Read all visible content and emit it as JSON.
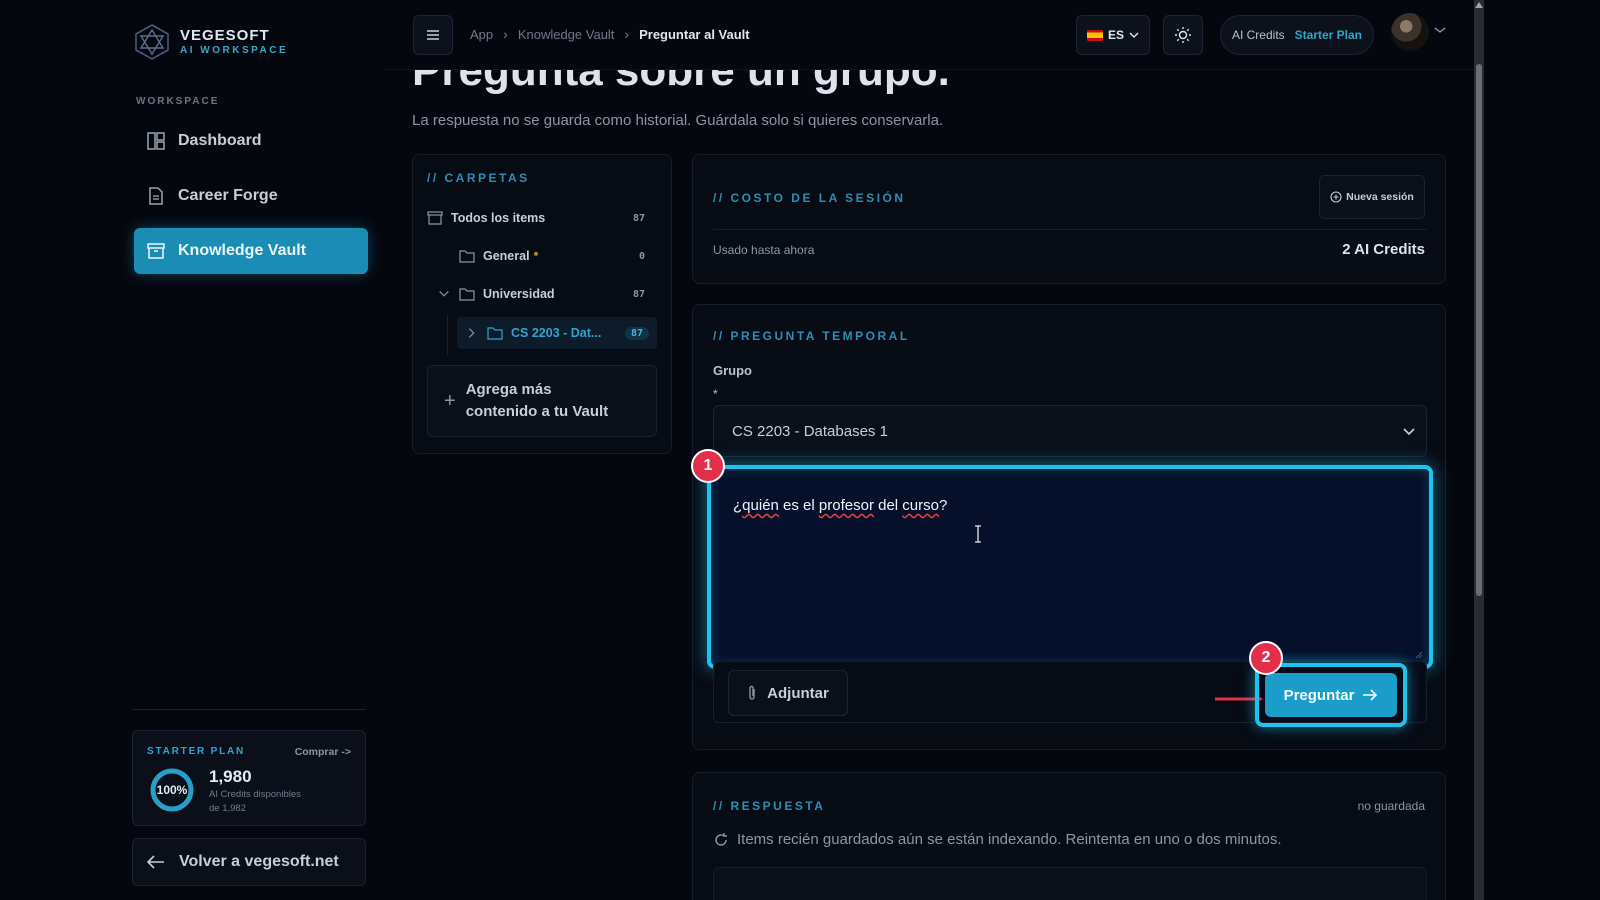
{
  "brand": {
    "name": "VEGESOFT",
    "subtitle": "AI WORKSPACE"
  },
  "sidebar": {
    "section_label": "WORKSPACE",
    "items": [
      {
        "label": "Dashboard",
        "icon": "dashboard-icon",
        "active": false
      },
      {
        "label": "Career Forge",
        "icon": "document-icon",
        "active": false
      },
      {
        "label": "Knowledge Vault",
        "icon": "archive-icon",
        "active": true
      }
    ],
    "plan": {
      "title": "STARTER PLAN",
      "buy_label": "Comprar ->",
      "percent_label": "100%",
      "percent_value": 1.0,
      "credits": "1,980",
      "credits_caption": "AI Credits disponibles",
      "credits_total": "de 1,982"
    },
    "back_label": "Volver a vegesoft.net"
  },
  "topbar": {
    "breadcrumb": [
      "App",
      "Knowledge Vault",
      "Preguntar al Vault"
    ],
    "language": "ES",
    "credits_label": "AI Credits",
    "plan_label": "Starter Plan"
  },
  "page": {
    "title": "Pregunta sobre un grupo.",
    "subtitle": "La respuesta no se guarda como historial. Guárdala solo si quieres conservarla."
  },
  "folders": {
    "title": "// CARPETAS",
    "items": [
      {
        "label": "Todos los items",
        "count": "87"
      },
      {
        "label": "General",
        "count": "0",
        "starred": true
      },
      {
        "label": "Universidad",
        "count": "87",
        "expanded": true
      },
      {
        "label": "CS 2203 - Dat...",
        "count": "87",
        "selected": true
      }
    ],
    "add_more_line1": "Agrega más",
    "add_more_line2": "contenido a tu Vault"
  },
  "cost": {
    "title": "// COSTO DE LA SESIÓN",
    "new_session_label": "Nueva sesión",
    "used_label": "Usado hasta ahora",
    "used_value": "2 AI Credits"
  },
  "question": {
    "title": "// PREGUNTA TEMPORAL",
    "group_label": "Grupo",
    "required_mark": "*",
    "group_value": "CS 2203 - Databases 1",
    "text_parts": [
      "¿",
      "quién",
      " es el ",
      "profesor",
      " del ",
      "curso",
      "?"
    ],
    "attach_label": "Adjuntar",
    "ask_label": "Preguntar",
    "badge_1": "1",
    "badge_2": "2"
  },
  "answer": {
    "title": "// RESPUESTA",
    "status": "no guardada",
    "info": "Items recién guardados aún se están indexando. Reintenta en uno o dos minutos."
  }
}
